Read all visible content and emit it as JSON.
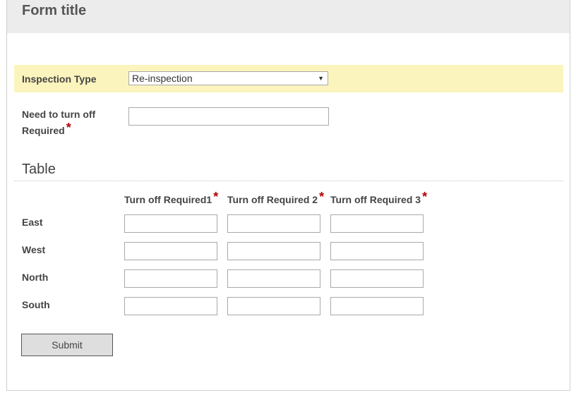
{
  "form": {
    "title": "Form title"
  },
  "inspection_type": {
    "label": "Inspection Type",
    "selected": "Re-inspection"
  },
  "need_turn_off": {
    "label_line1": "Need to turn off",
    "label_line2": "Required",
    "required_mark": "*",
    "value": ""
  },
  "table": {
    "title": "Table",
    "columns": [
      {
        "label": "Turn off Required1",
        "required_mark": "*"
      },
      {
        "label": "Turn off Required 2",
        "required_mark": "*"
      },
      {
        "label": "Turn off Required 3",
        "required_mark": "*"
      }
    ],
    "rows": [
      {
        "label": "East",
        "values": [
          "",
          "",
          ""
        ]
      },
      {
        "label": "West",
        "values": [
          "",
          "",
          ""
        ]
      },
      {
        "label": "North",
        "values": [
          "",
          "",
          ""
        ]
      },
      {
        "label": "South",
        "values": [
          "",
          "",
          ""
        ]
      }
    ]
  },
  "submit": {
    "label": "Submit"
  }
}
